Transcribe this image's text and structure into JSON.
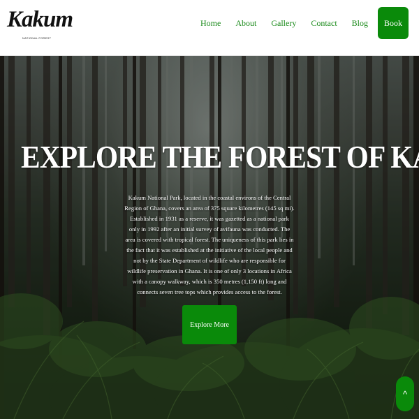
{
  "brand": {
    "logo_text": "Kakum",
    "tagline": "NATIONAL FOREST"
  },
  "nav": {
    "items": [
      {
        "label": "Home"
      },
      {
        "label": "About"
      },
      {
        "label": "Gallery"
      },
      {
        "label": "Contact"
      },
      {
        "label": "Blog"
      }
    ],
    "book_label": "Book"
  },
  "hero": {
    "title": "EXPLORE THE FOREST OF KAKUM",
    "description": "Kakum National Park, located in the coastal environs of the Central Region of Ghana, covers an area of 375 square kilometres (145 sq mi). Established in 1931 as a reserve, it was gazetted as a national park only in 1992 after an initial survey of avifauna was conducted. The area is covered with tropical forest. The uniqueness of this park lies in the fact that it was established at the initiative of the local people and not by the State Department of wildlife who are responsible for wildlife preservation in Ghana. It is one of only 3 locations in Africa with a canopy walkway, which is 350 metres (1,150 ft) long and connects seven tree tops which provides access to the forest.",
    "cta_label": "Explore More"
  },
  "scroll_top": {
    "icon": "chevron-up-icon",
    "glyph": "^"
  },
  "colors": {
    "accent": "#0a8a0a",
    "nav_link": "#1a8a1a",
    "text_on_hero": "#ffffff"
  }
}
